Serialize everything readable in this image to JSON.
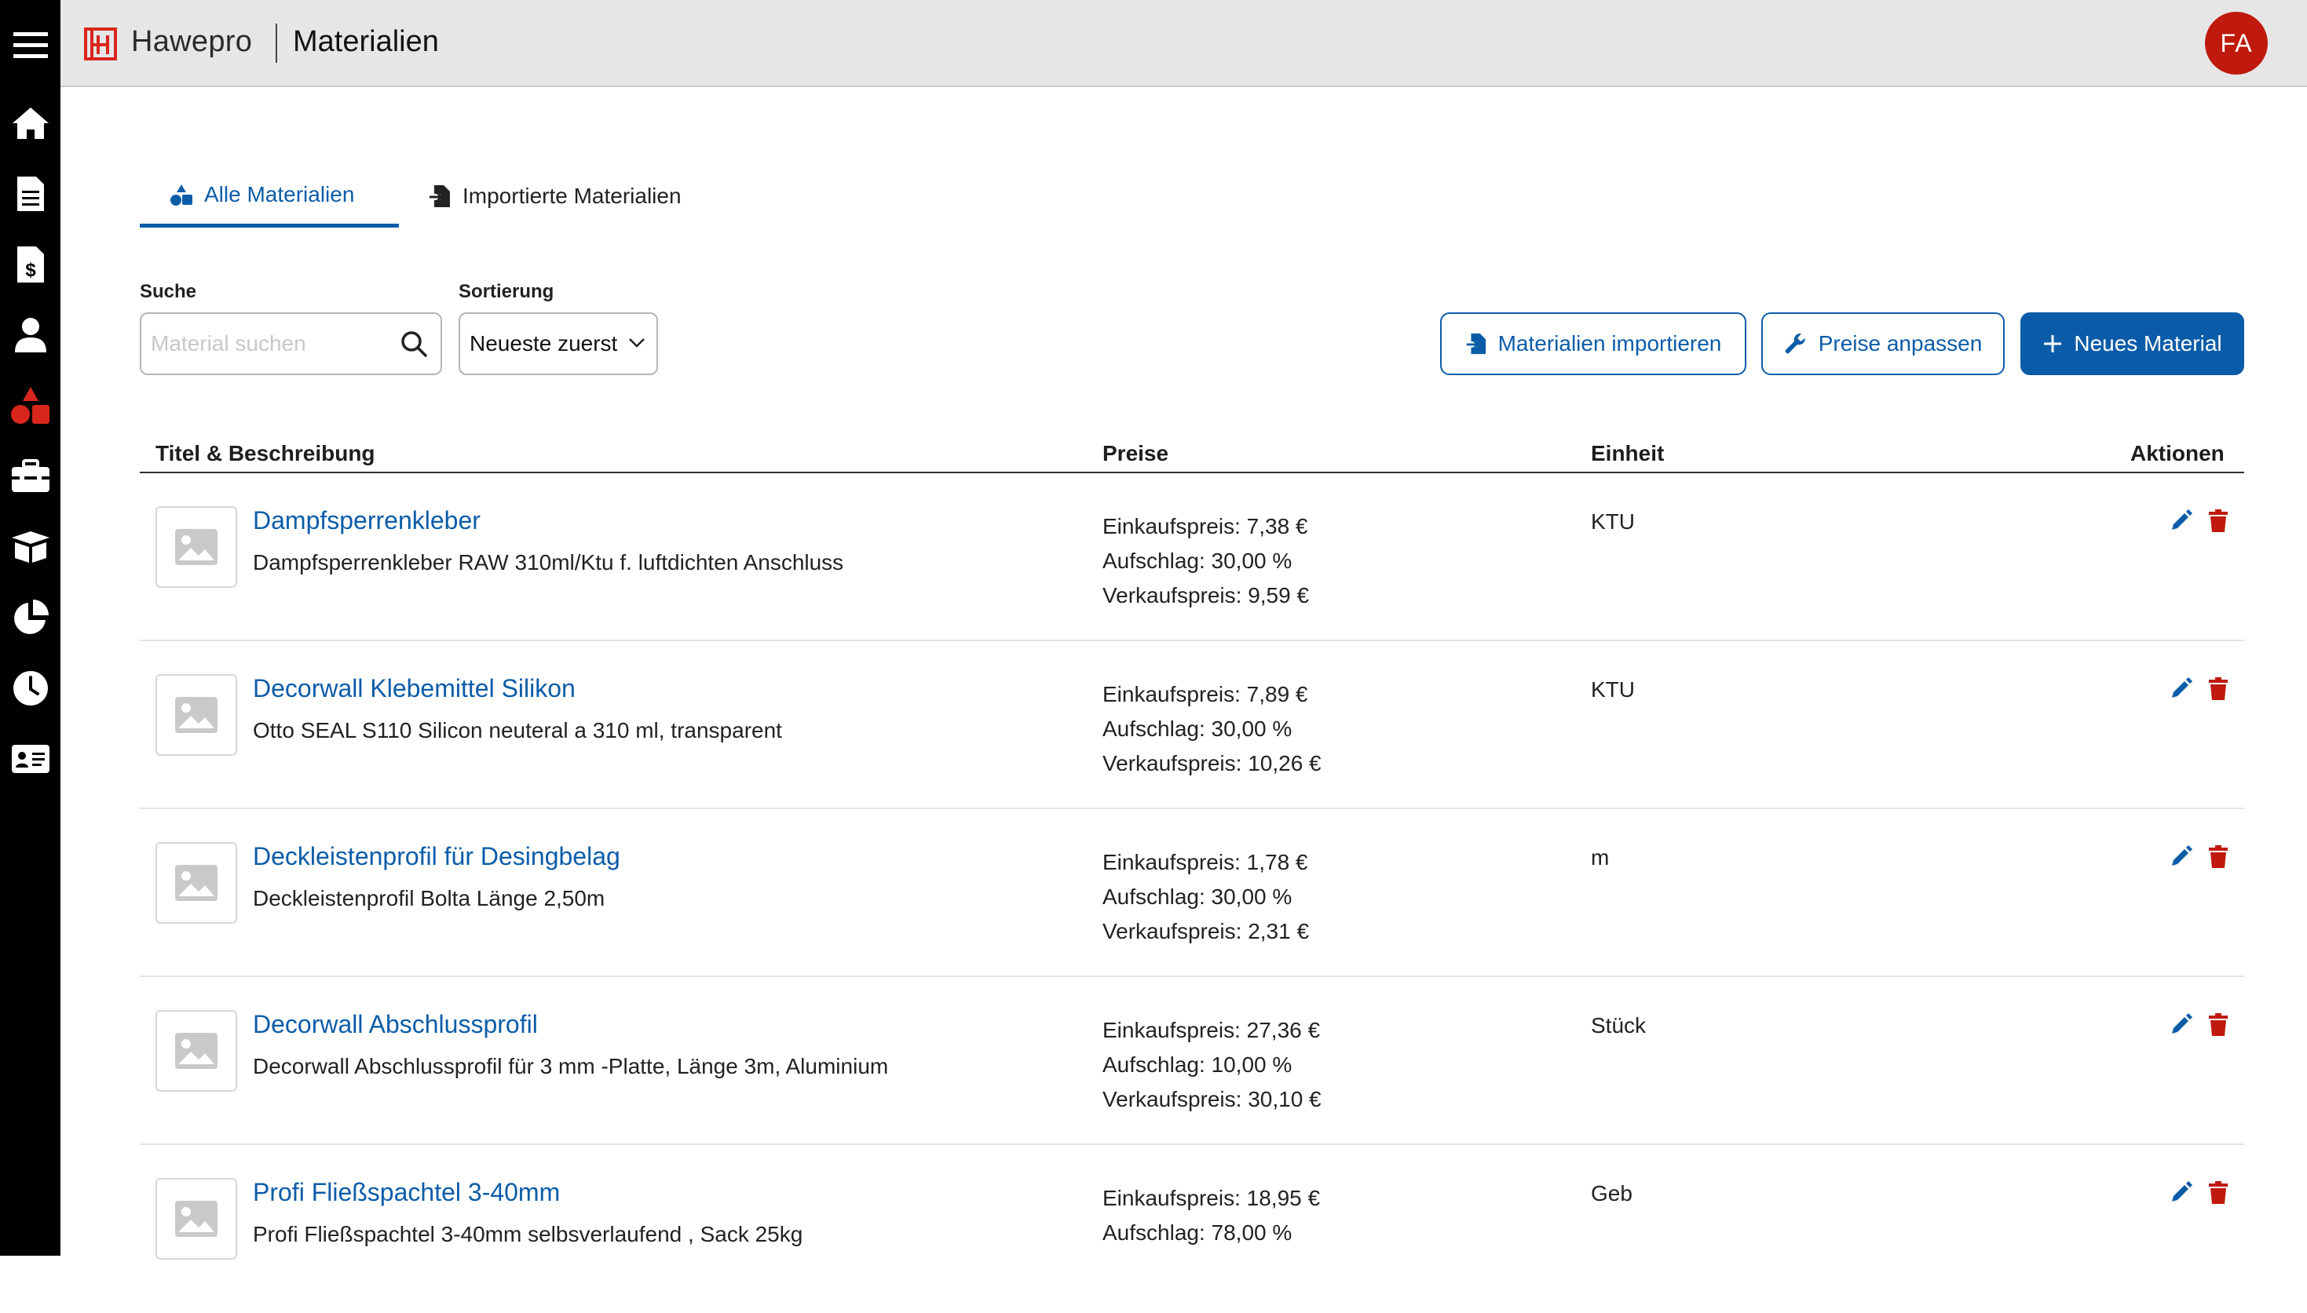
{
  "header": {
    "brand": "Hawepro",
    "title": "Materialien",
    "avatar_initials": "FA"
  },
  "sidebar": {
    "items": [
      {
        "icon": "menu-icon"
      },
      {
        "icon": "home-icon"
      },
      {
        "icon": "document-icon"
      },
      {
        "icon": "invoice-icon"
      },
      {
        "icon": "user-icon"
      },
      {
        "icon": "materials-icon",
        "active": true
      },
      {
        "icon": "toolbox-icon"
      },
      {
        "icon": "box-icon"
      },
      {
        "icon": "pie-chart-icon"
      },
      {
        "icon": "clock-icon"
      },
      {
        "icon": "id-card-icon"
      }
    ]
  },
  "tabs": [
    {
      "label": "Alle Materialien",
      "icon": "shapes-icon",
      "active": true
    },
    {
      "label": "Importierte Materialien",
      "icon": "file-import-icon",
      "active": false
    }
  ],
  "filters": {
    "search_label": "Suche",
    "search_placeholder": "Material suchen",
    "sort_label": "Sortierung",
    "sort_value": "Neueste zuerst"
  },
  "actions": {
    "import_label": "Materialien importieren",
    "prices_label": "Preise anpassen",
    "new_label": "Neues Material"
  },
  "table": {
    "columns": [
      "Titel & Beschreibung",
      "Preise",
      "Einheit",
      "Aktionen"
    ],
    "rows": [
      {
        "title": "Dampfsperrenkleber",
        "description": "Dampfsperrenkleber RAW 310ml/Ktu f. luftdichten Anschluss",
        "einkauf": "Einkaufspreis: 7,38 €",
        "aufschlag": "Aufschlag: 30,00 %",
        "verkauf": "Verkaufspreis: 9,59 €",
        "unit": "KTU"
      },
      {
        "title": "Decorwall Klebemittel Silikon",
        "description": "Otto SEAL S110 Silicon neuteral a 310 ml, transparent",
        "einkauf": "Einkaufspreis: 7,89 €",
        "aufschlag": "Aufschlag: 30,00 %",
        "verkauf": "Verkaufspreis: 10,26 €",
        "unit": "KTU"
      },
      {
        "title": "Deckleistenprofil für Desingbelag",
        "description": "Deckleistenprofil Bolta Länge 2,50m",
        "einkauf": "Einkaufspreis: 1,78 €",
        "aufschlag": "Aufschlag: 30,00 %",
        "verkauf": "Verkaufspreis: 2,31 €",
        "unit": "m"
      },
      {
        "title": "Decorwall Abschlussprofil",
        "description": "Decorwall Abschlussprofil für 3 mm -Platte, Länge 3m, Aluminium",
        "einkauf": "Einkaufspreis: 27,36 €",
        "aufschlag": "Aufschlag: 10,00 %",
        "verkauf": "Verkaufspreis: 30,10 €",
        "unit": "Stück"
      },
      {
        "title": "Profi Fließspachtel 3-40mm",
        "description": "Profi Fließspachtel 3-40mm selbsverlaufend , Sack 25kg",
        "einkauf": "Einkaufspreis: 18,95 €",
        "aufschlag": "Aufschlag: 78,00 %",
        "verkauf": "",
        "unit": "Geb"
      }
    ]
  },
  "colors": {
    "accent": "#0b5ca8",
    "danger": "#bf1a0d",
    "sidebar": "#000000",
    "topbar": "#e6e6e6"
  }
}
